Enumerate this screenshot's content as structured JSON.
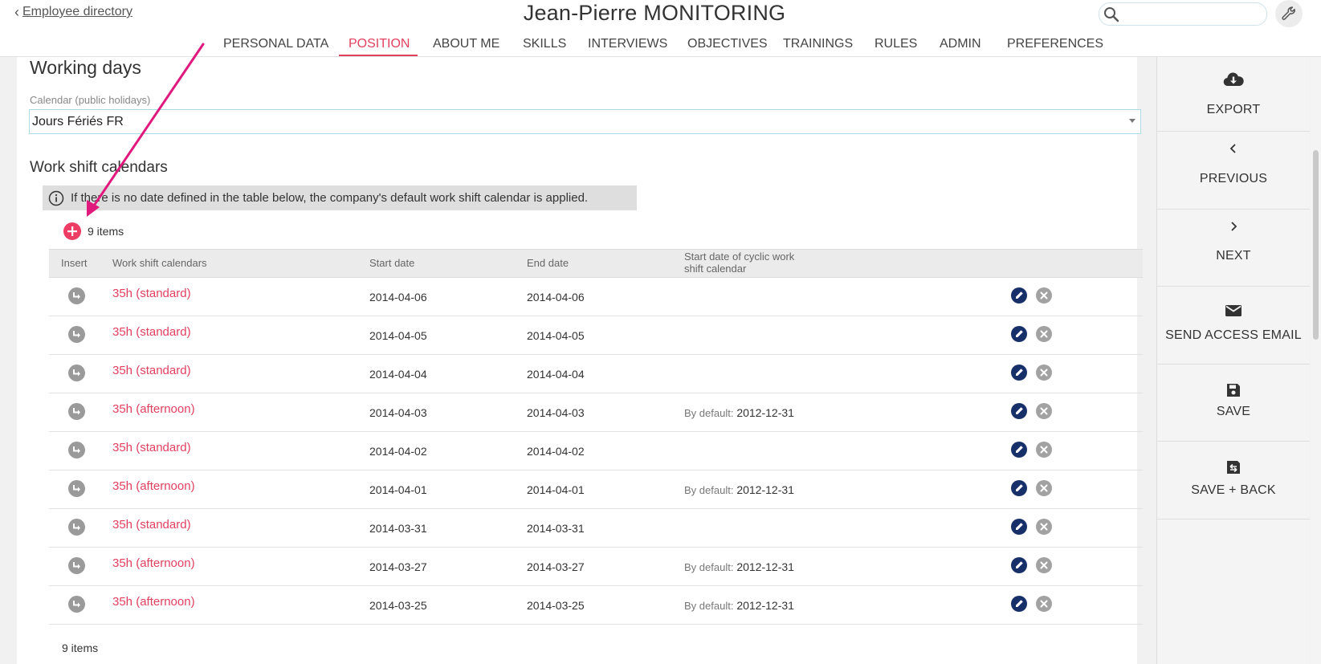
{
  "header": {
    "back_label": "Employee directory",
    "title": "Jean-Pierre MONITORING",
    "search_placeholder": "",
    "search_icon": "search-icon",
    "settings_icon": "wrench-icon"
  },
  "tabs": [
    {
      "label": "PERSONAL DATA"
    },
    {
      "label": "POSITION",
      "active": true
    },
    {
      "label": "ABOUT ME"
    },
    {
      "label": "SKILLS"
    },
    {
      "label": "INTERVIEWS"
    },
    {
      "label": "OBJECTIVES"
    },
    {
      "label": "TRAININGS"
    },
    {
      "label": "RULES"
    },
    {
      "label": "ADMIN"
    },
    {
      "label": "PREFERENCES"
    }
  ],
  "working_days": {
    "title": "Working days",
    "calendar_label": "Calendar (public holidays)",
    "calendar_value": "Jours Fériés FR"
  },
  "work_shift": {
    "title": "Work shift calendars",
    "info": "If there is no date defined in the table below, the company's default work shift calendar is applied.",
    "count_label": "9 items",
    "columns": {
      "insert": "Insert",
      "calendar": "Work shift calendars",
      "start": "Start date",
      "end": "End date",
      "cyclic_line1": "Start date of cyclic work",
      "cyclic_line2": "shift calendar"
    },
    "rows": [
      {
        "calendar": "35h (standard)",
        "start": "2014-04-06",
        "end": "2014-04-06",
        "cyclic_label": "",
        "cyclic_value": ""
      },
      {
        "calendar": "35h (standard)",
        "start": "2014-04-05",
        "end": "2014-04-05",
        "cyclic_label": "",
        "cyclic_value": ""
      },
      {
        "calendar": "35h (standard)",
        "start": "2014-04-04",
        "end": "2014-04-04",
        "cyclic_label": "",
        "cyclic_value": ""
      },
      {
        "calendar": "35h (afternoon)",
        "start": "2014-04-03",
        "end": "2014-04-03",
        "cyclic_label": "By default:",
        "cyclic_value": "2012-12-31"
      },
      {
        "calendar": "35h (standard)",
        "start": "2014-04-02",
        "end": "2014-04-02",
        "cyclic_label": "",
        "cyclic_value": ""
      },
      {
        "calendar": "35h (afternoon)",
        "start": "2014-04-01",
        "end": "2014-04-01",
        "cyclic_label": "By default:",
        "cyclic_value": "2012-12-31"
      },
      {
        "calendar": "35h (standard)",
        "start": "2014-03-31",
        "end": "2014-03-31",
        "cyclic_label": "",
        "cyclic_value": ""
      },
      {
        "calendar": "35h (afternoon)",
        "start": "2014-03-27",
        "end": "2014-03-27",
        "cyclic_label": "By default:",
        "cyclic_value": "2012-12-31"
      },
      {
        "calendar": "35h (afternoon)",
        "start": "2014-03-25",
        "end": "2014-03-25",
        "cyclic_label": "By default:",
        "cyclic_value": "2012-12-31"
      }
    ],
    "footer_count": "9 items"
  },
  "side_actions": [
    {
      "label": "EXPORT",
      "icon": "cloud-download-icon"
    },
    {
      "label": "PREVIOUS",
      "icon": "chevron-left-icon"
    },
    {
      "label": "NEXT",
      "icon": "chevron-right-icon"
    },
    {
      "label": "SEND ACCESS EMAIL",
      "icon": "mail-icon"
    },
    {
      "label": "SAVE",
      "icon": "floppy-disk-icon"
    },
    {
      "label": "SAVE + BACK",
      "icon": "save-back-icon"
    }
  ],
  "colors": {
    "accent": "#e2405f",
    "add_button": "#ee3d64",
    "edit_icon": "#17306a",
    "annotation_arrow": "#e0197d"
  }
}
